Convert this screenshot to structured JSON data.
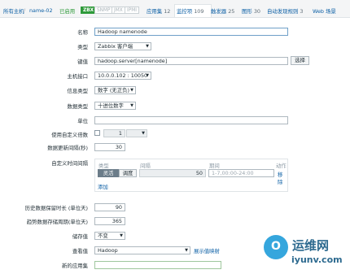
{
  "nav": {
    "all_hosts": "所有主机",
    "separator": "/",
    "host_name": "name-02",
    "status": "已启用",
    "badges": [
      "ZBX",
      "SNMP",
      "JMX",
      "IPMI"
    ],
    "tabs": [
      {
        "label": "应用集",
        "count": "12"
      },
      {
        "label": "监控项",
        "count": "109"
      },
      {
        "label": "触发器",
        "count": "25"
      },
      {
        "label": "图形",
        "count": "30"
      },
      {
        "label": "自动发现规则",
        "count": "3"
      },
      {
        "label": "Web 场景",
        "count": ""
      }
    ]
  },
  "form": {
    "name_label": "名称",
    "name_value": "Hadoop namenode",
    "type_label": "类型",
    "type_value": "Zabbix 客户端",
    "key_label": "键值",
    "key_value": "hadoop.server[namenode]",
    "select_button": "选择",
    "interface_label": "主机接口",
    "interface_value": "10.0.0.102 : 10050",
    "info_type_label": "信息类型",
    "info_type_value": "数字 (无正负)",
    "data_type_label": "数据类型",
    "data_type_value": "十进位数字",
    "unit_label": "单位",
    "unit_value": "",
    "custom_multiplier_label": "使用自定义倍数",
    "multiplier_value": "1",
    "interval_label": "数据更新间隔(秒)",
    "interval_value": "30",
    "custom_intervals_label": "自定义时间间隔",
    "custom_intervals": {
      "col_type": "类型",
      "col_interval": "间隔",
      "col_period": "期间",
      "col_action": "动作",
      "seg_flexible": "灵活",
      "seg_scheduling": "调度",
      "interval_value": "50",
      "period_placeholder": "1-7,00:00-24:00",
      "remove_link": "移除",
      "add_link": "添加"
    },
    "history_label": "历史数据保留时长 (单位天)",
    "history_value": "90",
    "trend_label": "趋势数据存储周期(单位天)",
    "trend_value": "365",
    "store_label": "储存值",
    "store_value": "不变",
    "show_value_label": "查看值",
    "show_value_value": "Hadoop",
    "show_value_link": "展示值映射",
    "new_app_label": "新的应用集",
    "new_app_value": ""
  },
  "watermark": {
    "circle_glyph": "O",
    "title": "运维网",
    "url": "iyunv.com"
  },
  "colors": {
    "accent": "#0b5fa5",
    "enabled": "#2e9a3a",
    "watermark_blue": "#35a6dd"
  }
}
